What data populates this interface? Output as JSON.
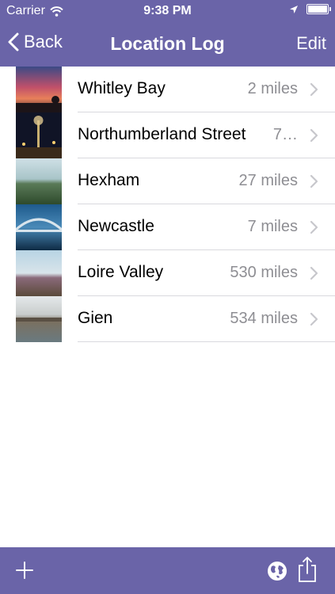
{
  "status_bar": {
    "carrier": "Carrier",
    "time": "9:38 PM",
    "icons": [
      "wifi-icon",
      "location-arrow-icon",
      "battery-icon"
    ]
  },
  "nav": {
    "back_label": "Back",
    "title": "Location Log",
    "edit_label": "Edit"
  },
  "locations": [
    {
      "name": "Whitley Bay",
      "distance": "2 miles"
    },
    {
      "name": "Northumberland Street",
      "distance": "7…"
    },
    {
      "name": "Hexham",
      "distance": "27 miles"
    },
    {
      "name": "Newcastle",
      "distance": "7 miles"
    },
    {
      "name": "Loire Valley",
      "distance": "530 miles"
    },
    {
      "name": "Gien",
      "distance": "534 miles"
    }
  ],
  "toolbar": {
    "icons": [
      "add-icon",
      "globe-icon",
      "share-icon"
    ]
  },
  "colors": {
    "bar": "#6a64a8",
    "separator": "#d9d9de",
    "secondary_text": "#8e8e93",
    "chevron": "#c7c7cc"
  }
}
